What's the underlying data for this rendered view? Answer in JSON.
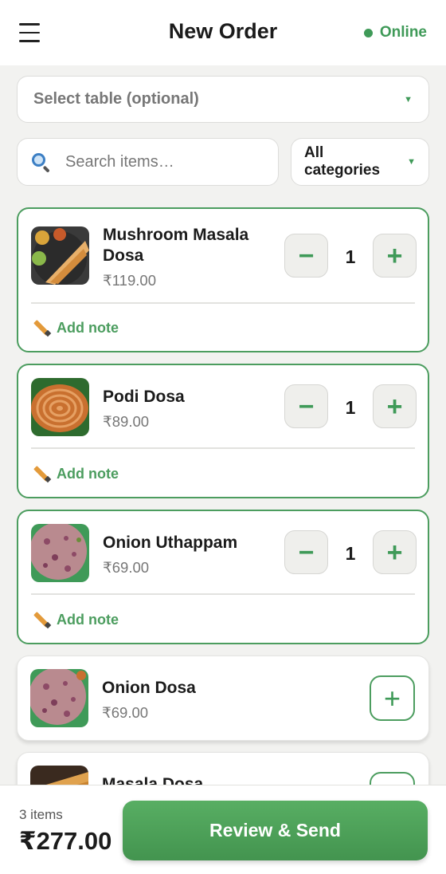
{
  "header": {
    "title": "New Order",
    "status": "Online",
    "status_color": "#3f9a58"
  },
  "table_select": {
    "label": "Select table (optional)"
  },
  "search": {
    "placeholder": "Search items…"
  },
  "category_select": {
    "label": "All categories"
  },
  "items": [
    {
      "name": "Mushroom Masala Dosa",
      "price": "₹119.00",
      "quantity": "1",
      "note_label": "Add note",
      "minus_label": "−",
      "plus_label": "+"
    },
    {
      "name": "Podi Dosa",
      "price": "₹89.00",
      "quantity": "1",
      "note_label": "Add note",
      "minus_label": "−",
      "plus_label": "+"
    },
    {
      "name": "Onion Uthappam",
      "price": "₹69.00",
      "quantity": "1",
      "note_label": "Add note",
      "minus_label": "−",
      "plus_label": "+"
    },
    {
      "name": "Onion Dosa",
      "price": "₹69.00",
      "plus_label": "+"
    },
    {
      "name": "Masala Dosa",
      "plus_label": "+"
    }
  ],
  "footer": {
    "items_count": "3 items",
    "total": "₹277.00",
    "review_label": "Review & Send"
  },
  "colors": {
    "accent": "#4c9d5f",
    "accent_dark": "#3f9a58"
  },
  "icons": {
    "menu": "hamburger-icon",
    "search": "magnifier-icon",
    "note": "pencil-icon"
  }
}
